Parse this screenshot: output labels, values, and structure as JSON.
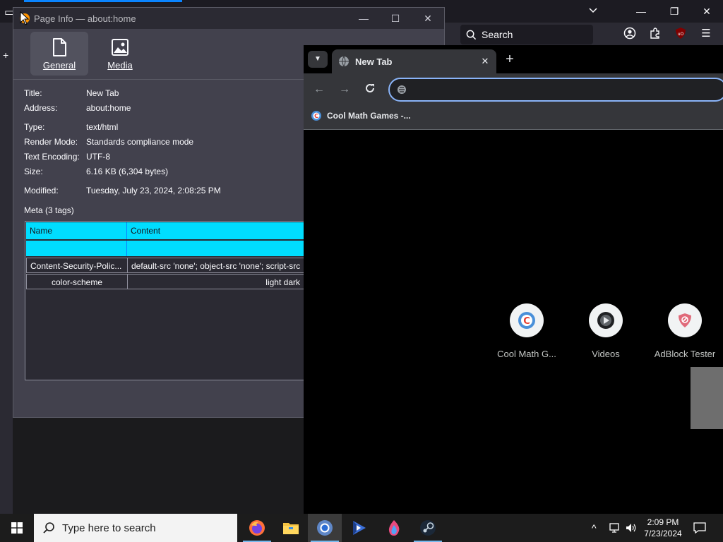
{
  "background_browser": {
    "search_placeholder": "Search"
  },
  "page_info": {
    "window_title": "Page Info — about:home",
    "tabs": [
      {
        "label": "General",
        "active": true
      },
      {
        "label": "Media",
        "active": false
      }
    ],
    "fields": [
      {
        "label": "Title:",
        "value": "New Tab"
      },
      {
        "label": "Address:",
        "value": "about:home"
      },
      {
        "label": "Type:",
        "value": "text/html"
      },
      {
        "label": "Render Mode:",
        "value": "Standards compliance mode"
      },
      {
        "label": "Text Encoding:",
        "value": "UTF-8"
      },
      {
        "label": "Size:",
        "value": "6.16 KB (6,304 bytes)"
      },
      {
        "label": "Modified:",
        "value": "Tuesday, July 23, 2024, 2:08:25 PM"
      }
    ],
    "meta_title": "Meta (3 tags)",
    "meta_table": {
      "columns": [
        "Name",
        "Content"
      ],
      "rows": [
        {
          "name": "",
          "content": ""
        },
        {
          "name": "Content-Security-Polic...",
          "content": "default-src 'none'; object-src 'none'; script-src"
        },
        {
          "name": "color-scheme",
          "content": "light dark"
        }
      ]
    }
  },
  "chrome": {
    "tab_title": "New Tab",
    "omnibox_value": "",
    "bookmark": "Cool Math Games -...",
    "shortcuts": [
      {
        "label": "Cool Math G...",
        "icon": "coolmath-icon"
      },
      {
        "label": "Videos",
        "icon": "play-icon"
      },
      {
        "label": "AdBlock Tester",
        "icon": "shield-icon"
      }
    ]
  },
  "taskbar": {
    "search_placeholder": "Type here to search",
    "time": "2:09 PM",
    "date": "7/23/2024"
  },
  "colors": {
    "accent": "#00ddff",
    "omnibox_focus": "#8ab4f8",
    "firefox_accent": "#0a84ff"
  }
}
